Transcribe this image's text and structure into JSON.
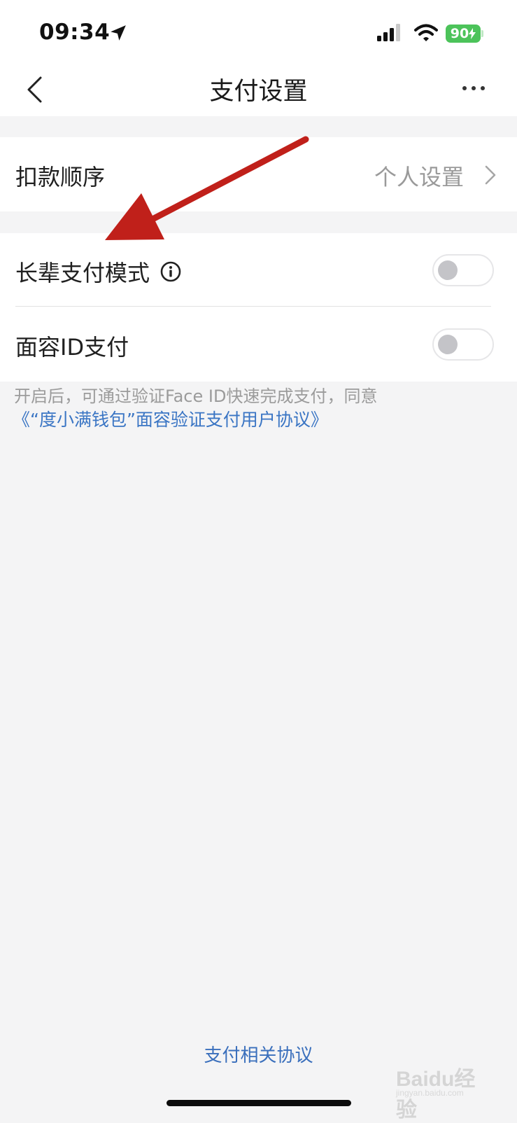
{
  "status_bar": {
    "time": "09:34",
    "battery": "90",
    "battery_color": "#4cc35a",
    "icons": [
      "location-arrow-icon",
      "signal-icon",
      "wifi-icon",
      "battery-charging-icon"
    ]
  },
  "nav": {
    "title": "支付设置",
    "back_icon": "chevron-left-icon",
    "more_icon": "more-horizontal-icon"
  },
  "rows": {
    "deduction_order": {
      "label": "扣款顺序",
      "value": "个人设置"
    },
    "elder_mode": {
      "label": "长辈支付模式",
      "info_icon": "info-circle-icon",
      "toggle_on": false
    },
    "face_id": {
      "label": "面容ID支付",
      "toggle_on": false
    }
  },
  "hint": {
    "text": "开启后，可通过验证Face ID快速完成支付，同意",
    "link": "《“度小满钱包”面容验证支付用户协议》"
  },
  "footer": {
    "link": "支付相关协议"
  },
  "annotation": {
    "arrow_color": "#c0201a"
  },
  "watermark": {
    "brand": "Baidu经验",
    "domain": "jingyan.baidu.com"
  },
  "colors": {
    "accent_link": "#3a75c4",
    "background": "#f4f4f5"
  }
}
